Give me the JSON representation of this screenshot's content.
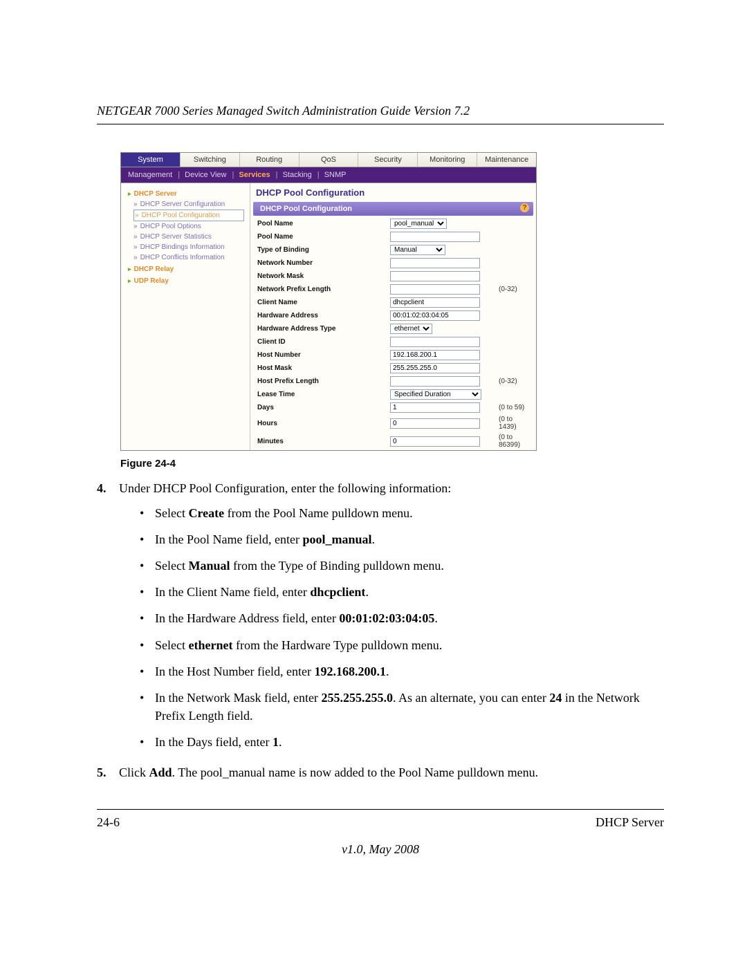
{
  "doc": {
    "header": "NETGEAR 7000 Series Managed Switch Administration Guide Version 7.2",
    "figure_label": "Figure 24-4",
    "footer_left": "24-6",
    "footer_right": "DHCP Server",
    "footer_version": "v1.0, May 2008"
  },
  "ui": {
    "tabs": [
      "System",
      "Switching",
      "Routing",
      "QoS",
      "Security",
      "Monitoring",
      "Maintenance"
    ],
    "active_tab": "System",
    "subnav": {
      "items": [
        "Management",
        "Device View",
        "Services",
        "Stacking",
        "SNMP"
      ],
      "active": "Services"
    },
    "sidebar": {
      "sections": [
        {
          "title": "DHCP Server",
          "items": [
            {
              "label": "DHCP Server Configuration"
            },
            {
              "label": "DHCP Pool Configuration",
              "selected": true
            },
            {
              "label": "DHCP Pool Options"
            },
            {
              "label": "DHCP Server Statistics"
            },
            {
              "label": "DHCP Bindings Information"
            },
            {
              "label": "DHCP Conflicts Information"
            }
          ]
        },
        {
          "title": "DHCP Relay",
          "items": []
        },
        {
          "title": "UDP Relay",
          "items": []
        }
      ]
    },
    "main": {
      "title": "DHCP Pool Configuration",
      "section_title": "DHCP Pool Configuration",
      "fields": [
        {
          "label": "Pool Name",
          "type": "select",
          "value": "pool_manual"
        },
        {
          "label": "Pool Name",
          "type": "text",
          "value": ""
        },
        {
          "label": "Type of Binding",
          "type": "select",
          "value": "Manual"
        },
        {
          "label": "Network Number",
          "type": "text",
          "value": ""
        },
        {
          "label": "Network Mask",
          "type": "text",
          "value": ""
        },
        {
          "label": "Network Prefix Length",
          "type": "text",
          "value": "",
          "hint": "(0-32)"
        },
        {
          "label": "Client Name",
          "type": "text",
          "value": "dhcpclient"
        },
        {
          "label": "Hardware Address",
          "type": "text",
          "value": "00:01:02:03:04:05"
        },
        {
          "label": "Hardware Address Type",
          "type": "select",
          "value": "ethernet"
        },
        {
          "label": "Client ID",
          "type": "text",
          "value": ""
        },
        {
          "label": "Host Number",
          "type": "text",
          "value": "192.168.200.1"
        },
        {
          "label": "Host Mask",
          "type": "text",
          "value": "255.255.255.0"
        },
        {
          "label": "Host Prefix Length",
          "type": "text",
          "value": "",
          "hint": "(0-32)"
        },
        {
          "label": "Lease Time",
          "type": "select",
          "value": "Specified Duration"
        },
        {
          "label": "Days",
          "type": "text",
          "value": "1",
          "hint": "(0 to 59)"
        },
        {
          "label": "Hours",
          "type": "text",
          "value": "0",
          "hint": "(0 to 1439)"
        },
        {
          "label": "Minutes",
          "type": "text",
          "value": "0",
          "hint": "(0 to 86399)"
        }
      ]
    }
  },
  "instr": {
    "step4_intro": "Under DHCP Pool Configuration, enter the following information:",
    "step4_bullets": [
      {
        "pre": "Select ",
        "bold": "Create",
        "post": " from the Pool Name pulldown menu."
      },
      {
        "pre": "In the Pool Name field, enter ",
        "bold": "pool_manual",
        "post": "."
      },
      {
        "pre": "Select ",
        "bold": "Manual",
        "post": " from the Type of Binding pulldown menu."
      },
      {
        "pre": "In the Client Name field, enter ",
        "bold": "dhcpclient",
        "post": "."
      },
      {
        "pre": "In the Hardware Address field, enter ",
        "bold": "00:01:02:03:04:05",
        "post": "."
      },
      {
        "pre": "Select ",
        "bold": "ethernet",
        "post": " from the Hardware Type pulldown menu."
      },
      {
        "pre": "In the Host Number field, enter ",
        "bold": "192.168.200.1",
        "post": "."
      },
      {
        "pre": "In the Network Mask field, enter ",
        "bold": "255.255.255.0",
        "post": ". As an alternate, you can enter ",
        "bold2": "24",
        "post2": " in the Network Prefix Length field."
      },
      {
        "pre": "In the Days field, enter ",
        "bold": "1",
        "post": "."
      }
    ],
    "step5_pre": "Click ",
    "step5_bold": "Add",
    "step5_post": ". The pool_manual name is now added to the Pool Name pulldown menu."
  }
}
